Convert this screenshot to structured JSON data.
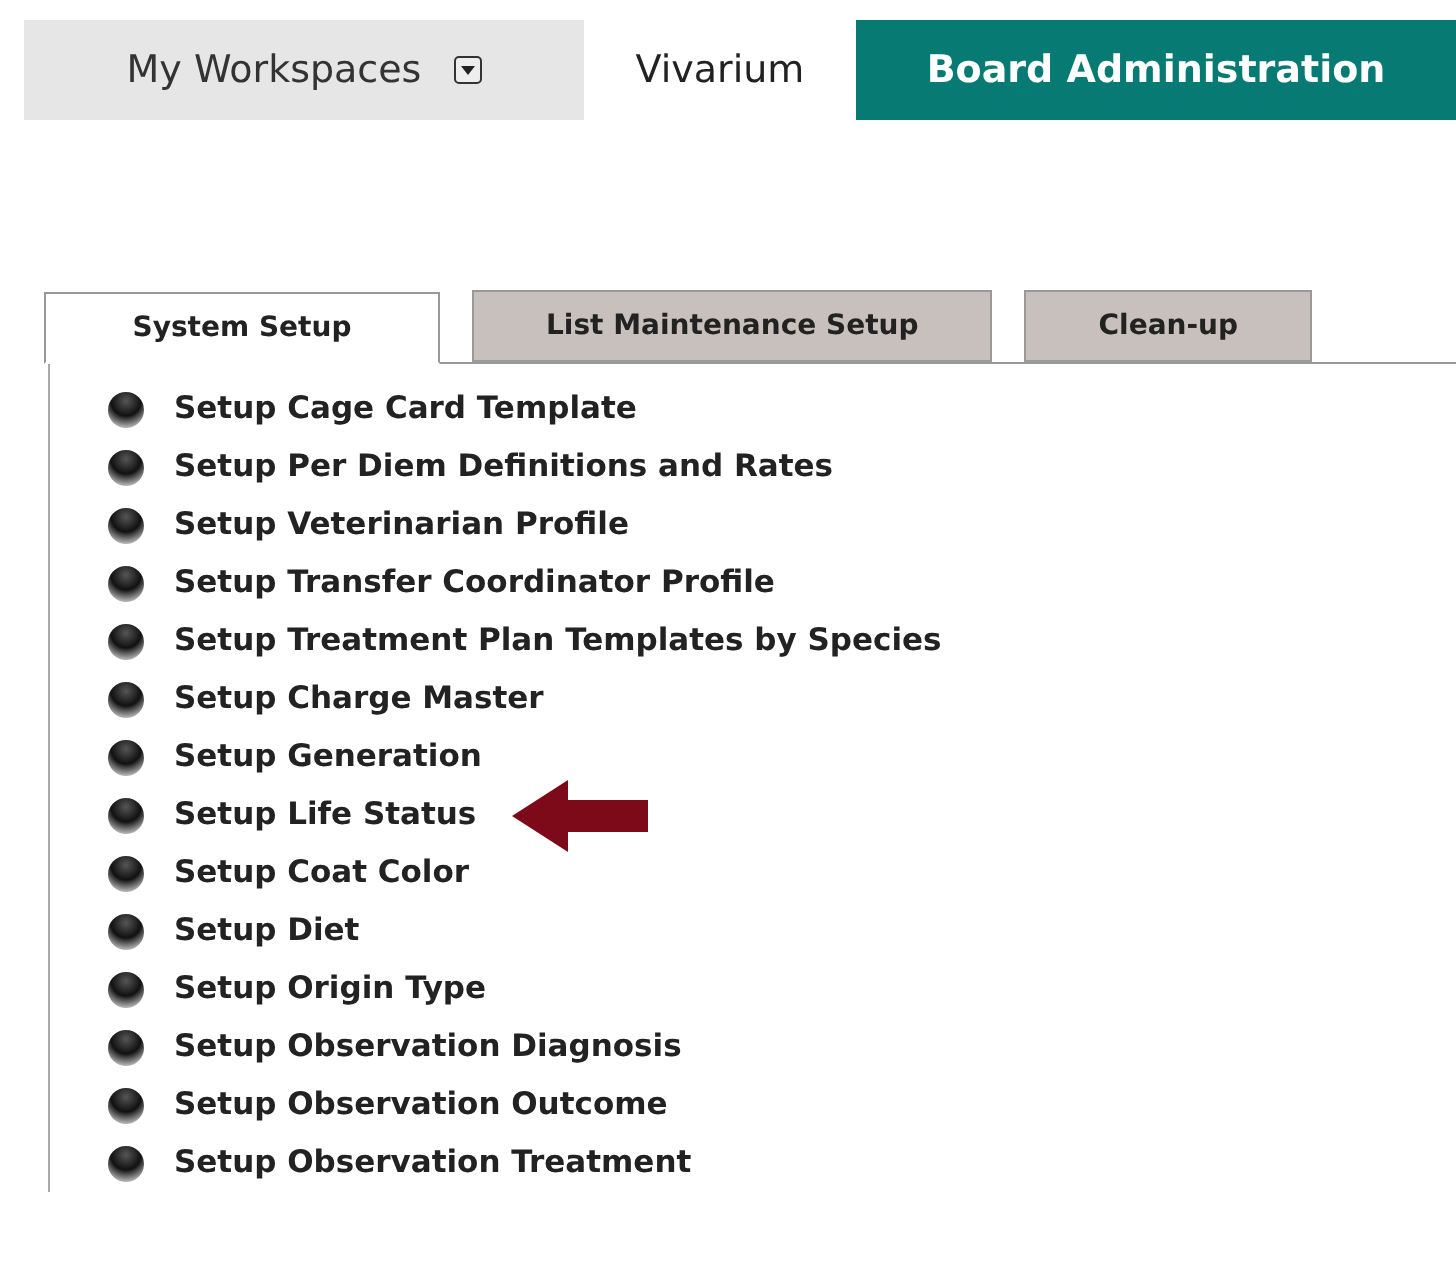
{
  "nav": [
    {
      "label": "My Workspaces",
      "kind": "dropdown",
      "selected": false
    },
    {
      "label": "Vivarium",
      "kind": "link",
      "selected": false
    },
    {
      "label": "Board Administration",
      "kind": "link",
      "selected": true
    }
  ],
  "tabs": [
    {
      "label": "System Setup",
      "selected": true
    },
    {
      "label": "List Maintenance Setup",
      "selected": false
    },
    {
      "label": "Clean-up",
      "selected": false
    }
  ],
  "items": [
    {
      "label": "Setup Cage Card Template",
      "pointed": false
    },
    {
      "label": "Setup Per Diem Definitions and Rates",
      "pointed": false
    },
    {
      "label": "Setup Veterinarian Profile",
      "pointed": false
    },
    {
      "label": "Setup Transfer Coordinator Profile",
      "pointed": false
    },
    {
      "label": "Setup Treatment Plan Templates by Species",
      "pointed": false
    },
    {
      "label": "Setup Charge Master",
      "pointed": false
    },
    {
      "label": "Setup Generation",
      "pointed": false
    },
    {
      "label": "Setup Life Status",
      "pointed": true
    },
    {
      "label": "Setup Coat Color",
      "pointed": false
    },
    {
      "label": "Setup Diet",
      "pointed": false
    },
    {
      "label": "Setup Origin Type",
      "pointed": false
    },
    {
      "label": "Setup Observation Diagnosis",
      "pointed": false
    },
    {
      "label": "Setup Observation Outcome",
      "pointed": false
    },
    {
      "label": "Setup Observation Treatment",
      "pointed": false
    }
  ]
}
